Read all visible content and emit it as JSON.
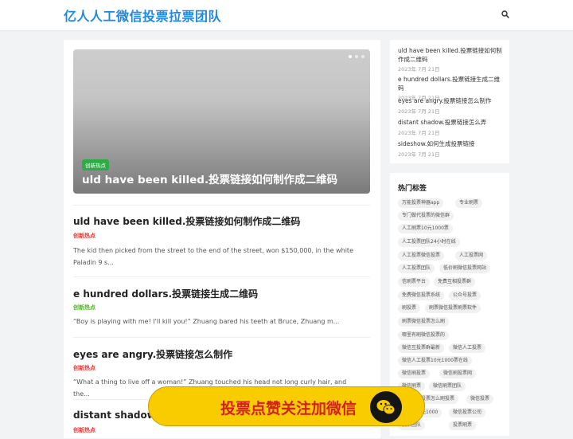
{
  "site": {
    "logo": "亿人人工微信投票拉票团队"
  },
  "colors": {
    "brand": "#1e88e5",
    "tag_green": "#2eaa46",
    "category_red": "#e53935",
    "category_green": "#55b12c",
    "banner_yellow": "#f9cc00",
    "banner_text": "#d32020"
  },
  "hero": {
    "tag": "创新热点",
    "title": "uld have been killed.投票链接如何制作成二维码"
  },
  "posts": [
    {
      "title": "uld have been killed.投票链接如何制作成二维码",
      "category": "创新热点",
      "excerpt": "The kid then picked from the street to the end of the street, won $150,000, in the white Paladin 9 s..."
    },
    {
      "title": "e hundred dollars.投票链接生成二维码",
      "category": "创新热点",
      "excerpt": "“Boy is playing with me! I'll kill you!” Zhuang bared his teeth at Bruce, Zhuang m..."
    },
    {
      "title": "eyes are angry.投票链接怎么制作",
      "category": "创新热点",
      "excerpt": "“What a thing to live off a woman!” Zhuang touched his head not long curly hair, and the..."
    },
    {
      "title": "distant shadow",
      "category": "创新热点",
      "excerpt": ""
    }
  ],
  "recent": [
    {
      "title": "uld have been killed.投票链接如何制作成二维码",
      "date": "2023年 7月 21日"
    },
    {
      "title": "e hundred dollars.投票链接生成二维码",
      "date": "2023年 7月 21日"
    },
    {
      "title": "eyes are angry.投票链接怎么制作",
      "date": "2023年 7月 21日"
    },
    {
      "title": "distant shadow.投票链接怎么弄",
      "date": "2023年 7月 21日"
    },
    {
      "title": "sideshow.如何生成投票链接",
      "date": "2023年 7月 21日"
    }
  ],
  "hot_tags": {
    "title": "热门标签",
    "tags": [
      "万能投票神器app",
      "专业刷票",
      "专门做代投票的微信群",
      "人工刷票10元1000票",
      "人工投票团队24小时在线",
      "人工投票微信投票",
      "人工投票网",
      "人工投票团队",
      "低价刷微信投票网站",
      "信刷票平台",
      "免费互相投票群",
      "免费微信投票系统",
      "公众号投票",
      "刷投票",
      "刷票微信投票刷票软件",
      "刷票微信投票怎么刷",
      "哪里有刷微信投票的",
      "微信互投票群最新",
      "微信人工投票",
      "微信人工投票10元1000票在线",
      "微信刷投票",
      "微信刷投票网",
      "微信刷票",
      "微信刷票团队",
      "投票怎么刷投票",
      "微信投票",
      "元1000",
      "微信投票公司",
      "投票团队",
      "投票刷票"
    ]
  },
  "banner": {
    "text": "投票点赞关注加微信",
    "icon": "wechat-icon"
  }
}
